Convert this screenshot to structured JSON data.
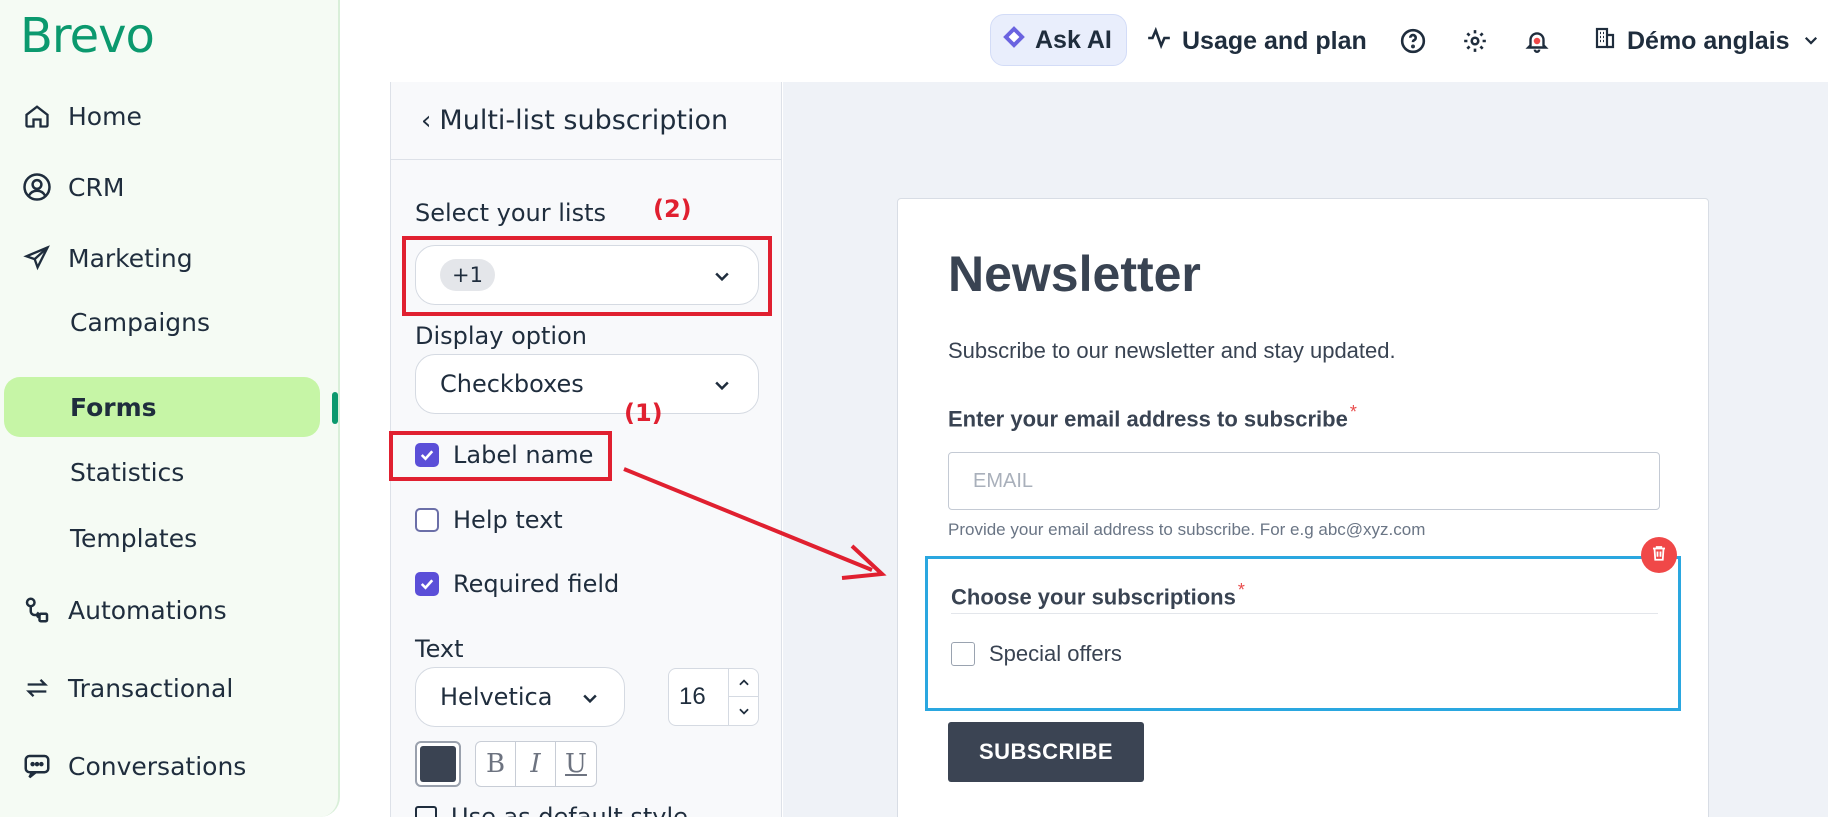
{
  "sidebar": {
    "logo": "Brevo",
    "items": [
      {
        "label": "Home",
        "icon": "home-icon"
      },
      {
        "label": "CRM",
        "icon": "user-circle-icon"
      },
      {
        "label": "Marketing",
        "icon": "send-icon"
      },
      {
        "label": "Automations",
        "icon": "automation-icon"
      },
      {
        "label": "Transactional",
        "icon": "arrows-icon"
      },
      {
        "label": "Conversations",
        "icon": "chat-icon"
      }
    ],
    "sub_items": [
      {
        "label": "Campaigns"
      },
      {
        "label": "Forms",
        "active": true
      },
      {
        "label": "Statistics"
      },
      {
        "label": "Templates"
      }
    ]
  },
  "topbar": {
    "ask_ai": "Ask AI",
    "usage": "Usage and plan",
    "account": "Démo anglais",
    "icons": [
      "help-icon",
      "gear-icon",
      "bell-icon",
      "building-icon"
    ]
  },
  "panel": {
    "title": "Multi-list subscription",
    "select_lists_label": "Select your lists",
    "lists_chip": "+1",
    "display_option_label": "Display option",
    "display_option_value": "Checkboxes",
    "options": [
      {
        "label": "Label name",
        "checked": true
      },
      {
        "label": "Help text",
        "checked": false
      },
      {
        "label": "Required field",
        "checked": true
      }
    ],
    "text_label": "Text",
    "font": "Helvetica",
    "font_size": "16",
    "text_color": "#3a4352",
    "style_buttons": [
      "B",
      "I",
      "U"
    ],
    "default_style_label": "Use as default style"
  },
  "form": {
    "title": "Newsletter",
    "description": "Subscribe to our newsletter and stay updated.",
    "email_label": "Enter your email address to subscribe",
    "required_mark": "*",
    "email_placeholder": "EMAIL",
    "email_help": "Provide your email address to subscribe. For e.g abc@xyz.com",
    "subscriptions_label": "Choose your subscriptions",
    "subscription_options": [
      "Special offers"
    ],
    "subscribe_button": "SUBSCRIBE"
  },
  "annotations": {
    "label_1": "(1)",
    "label_2": "(2)",
    "color": "#e02030"
  },
  "colors": {
    "brand": "#0b996e",
    "active_nav": "#c6f5a6",
    "checkbox": "#5b4fd8",
    "selected_field": "#2aa7e0",
    "button": "#3b4453"
  }
}
